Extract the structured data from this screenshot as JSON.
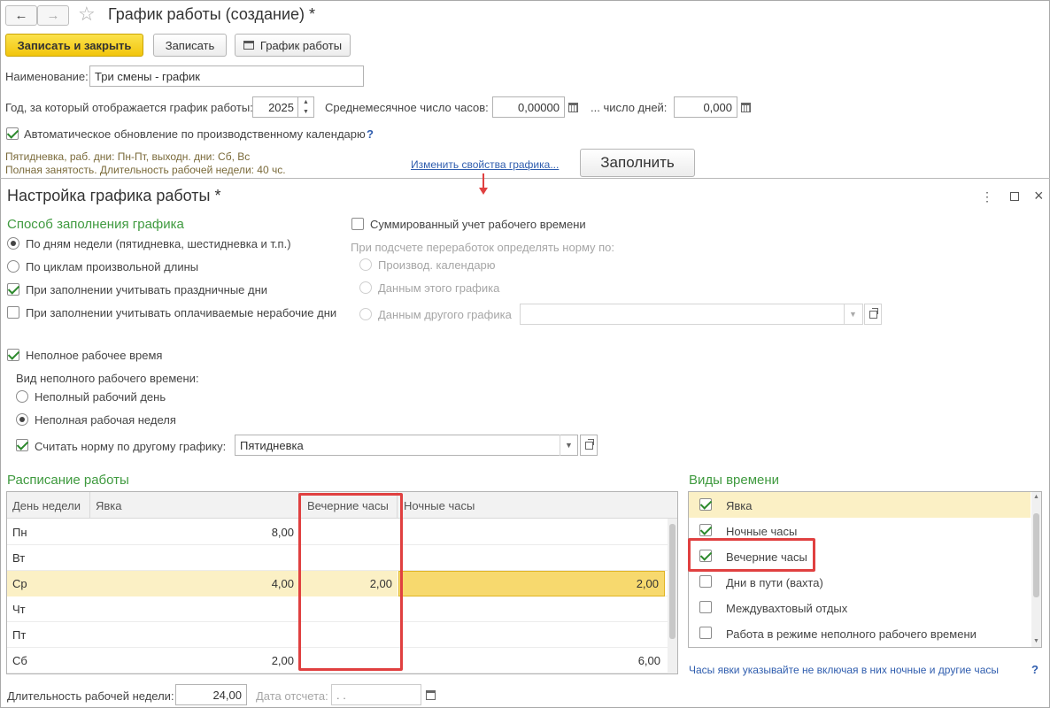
{
  "window": {
    "title": "График работы (создание) *"
  },
  "toolbar": {
    "save_close": "Записать и закрыть",
    "save": "Записать",
    "schedule": "График работы"
  },
  "form": {
    "name_label": "Наименование:",
    "name_value": "Три смены - график",
    "year_label": "Год, за который отображается график работы:",
    "year_value": "2025",
    "avg_hours_label": "Среднемесячное число часов:",
    "avg_hours_value": "0,00000",
    "days_label": "... число дней:",
    "days_value": "0,000",
    "auto_update_label": "Автоматическое обновление по производственному календарю",
    "help_mark": "?",
    "info_line1": "Пятидневка, раб. дни: Пн-Пт, выходн. дни: Сб, Вс",
    "info_line2": "Полная занятость. Длительность рабочей недели: 40 чс.",
    "change_link": "Изменить свойства графика...",
    "fill_button": "Заполнить"
  },
  "settings": {
    "title": "Настройка графика работы *",
    "fill_method_header": "Способ заполнения графика",
    "by_weekdays": "По дням недели (пятидневка, шестидневка и т.п.)",
    "by_cycles": "По циклам произвольной длины",
    "holidays": "При заполнении учитывать праздничные дни",
    "paid_nonwork": "При заполнении учитывать оплачиваемые нерабочие дни",
    "summarized": "Суммированный учет рабочего времени",
    "overtime_label": "При подсчете переработок определять норму по:",
    "prod_calendar": "Производ. календарю",
    "this_schedule": "Данным этого графика",
    "other_schedule": "Данным другого графика",
    "part_time": "Неполное рабочее время",
    "part_time_kind": "Вид неполного рабочего времени:",
    "part_day": "Неполный рабочий день",
    "part_week": "Неполная рабочая неделя",
    "norm_other": "Считать норму по другому графику:",
    "norm_other_value": "Пятидневка"
  },
  "schedule": {
    "header": "Расписание работы",
    "columns": [
      "День недели",
      "Явка",
      "Вечерние часы",
      "Ночные часы"
    ],
    "rows": [
      {
        "day": "Пн",
        "attend": "8,00",
        "evening": "",
        "night": ""
      },
      {
        "day": "Вт",
        "attend": "",
        "evening": "",
        "night": ""
      },
      {
        "day": "Ср",
        "attend": "4,00",
        "evening": "2,00",
        "night": "2,00"
      },
      {
        "day": "Чт",
        "attend": "",
        "evening": "",
        "night": ""
      },
      {
        "day": "Пт",
        "attend": "",
        "evening": "",
        "night": ""
      },
      {
        "day": "Сб",
        "attend": "2,00",
        "evening": "",
        "night": "6,00"
      }
    ]
  },
  "time_kinds": {
    "header": "Виды времени",
    "items": [
      {
        "label": "Явка",
        "checked": true
      },
      {
        "label": "Ночные часы",
        "checked": true
      },
      {
        "label": "Вечерние часы",
        "checked": true
      },
      {
        "label": "Дни в пути (вахта)",
        "checked": false
      },
      {
        "label": "Междувахтовый отдых",
        "checked": false
      },
      {
        "label": "Работа в режиме неполного рабочего времени",
        "checked": false
      }
    ],
    "hint": "Часы явки указывайте не включая в них ночные и другие часы",
    "help_mark": "?"
  },
  "footer": {
    "week_len_label": "Длительность рабочей недели:",
    "week_len_value": "24,00",
    "ref_date_label": "Дата отсчета:",
    "ref_date_value": " .  ."
  },
  "colors": {
    "accent_green": "#3f9a3f",
    "highlight_red": "#e04040",
    "primary_yellow": "#f2c50c",
    "selected_row": "#fbf0c5"
  }
}
